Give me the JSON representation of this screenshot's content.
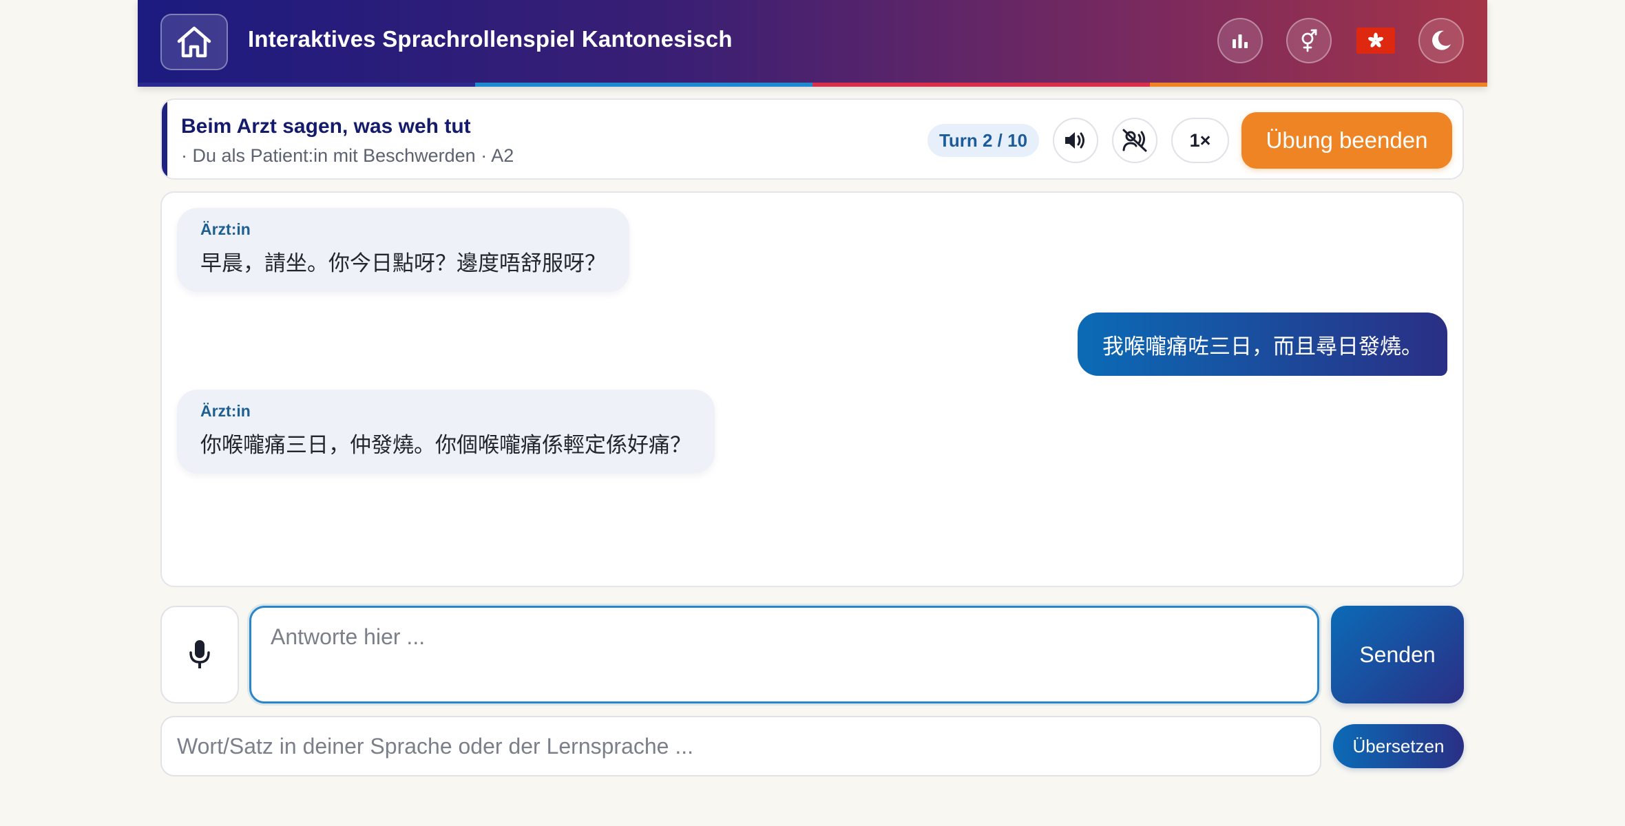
{
  "header": {
    "title": "Interaktives Sprachrollenspiel Kantonesisch",
    "stripe_colors": [
      "#2a2a8e",
      "#1e88d0",
      "#d92f4a",
      "#ee8424"
    ]
  },
  "scenario": {
    "title": "Beim Arzt sagen, was weh tut",
    "subtitle": "· Du als Patient:in mit Beschwerden · A2",
    "turn": "Turn 2 / 10",
    "speed": "1×",
    "end_label": "Übung beenden"
  },
  "messages": [
    {
      "role": "partner",
      "speaker": "Ärzt:in",
      "text": "早晨，請坐。你今日點呀？邊度唔舒服呀？"
    },
    {
      "role": "user",
      "text": "我喉嚨痛咗三日，而且尋日發燒。"
    },
    {
      "role": "partner",
      "speaker": "Ärzt:in",
      "text": "你喉嚨痛三日，仲發燒。你個喉嚨痛係輕定係好痛？"
    }
  ],
  "input": {
    "answer_placeholder": "Antworte hier ...",
    "send_label": "Senden",
    "translate_placeholder": "Wort/Satz in deiner Sprache oder der Lernsprache ...",
    "translate_label": "Übersetzen"
  },
  "colors": {
    "accent_orange": "#ee8424",
    "accent_blue": "#0b6bb6",
    "navy": "#1f2180"
  },
  "icons": [
    "home-icon",
    "stats-icon",
    "gender-icon",
    "hong-kong-flag-icon",
    "moon-icon",
    "speaker-icon",
    "speaker-muted-icon",
    "microphone-icon"
  ]
}
